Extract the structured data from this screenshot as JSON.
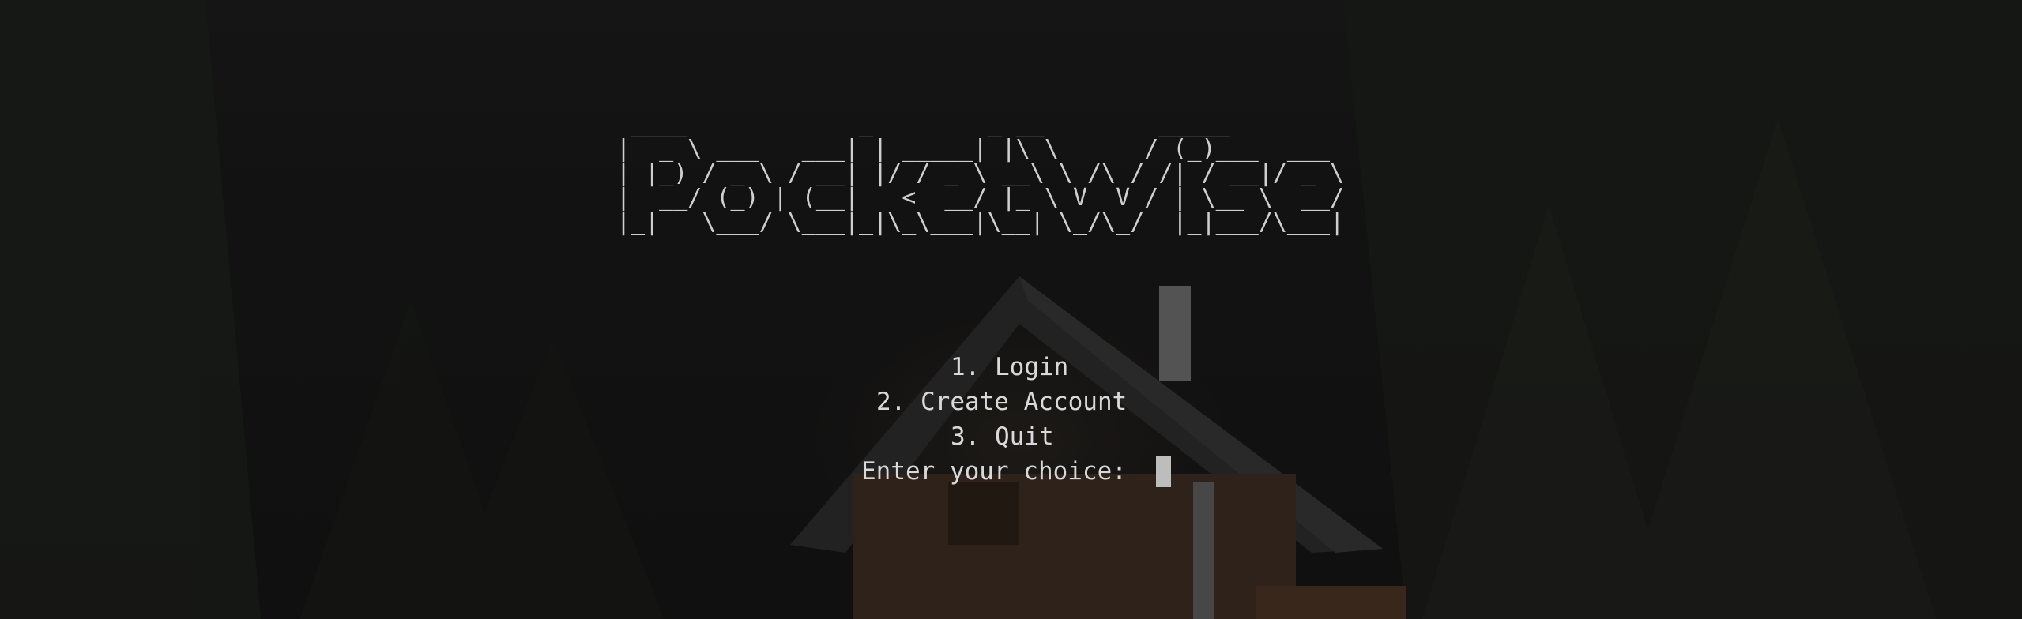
{
  "terminal": {
    "logo_lines": [
      " ____            _        _ __        _____",
      "|  _ \\ ___   ___| | _____| |\\ \\      / (_)___  ___",
      "| |_) / _ \\ / __| |/ / _ \\ __\\ \\ /\\ / /| / __|/ _ \\",
      "|  __/ (_) | (__|   <  __/ |_ \\ V  V / | \\__ \\  __/",
      "|_|   \\___/ \\___|_|\\_\\___|\\__| \\_/\\_/  |_|___/\\___|"
    ],
    "menu": {
      "option_login": "1. Login",
      "option_create_account": "2. Create Account",
      "option_quit": "3. Quit",
      "prompt": "Enter your choice: "
    }
  },
  "colors": {
    "text": "#d9d9d9",
    "cursor": "#bdbdbd",
    "background": "#141414"
  }
}
